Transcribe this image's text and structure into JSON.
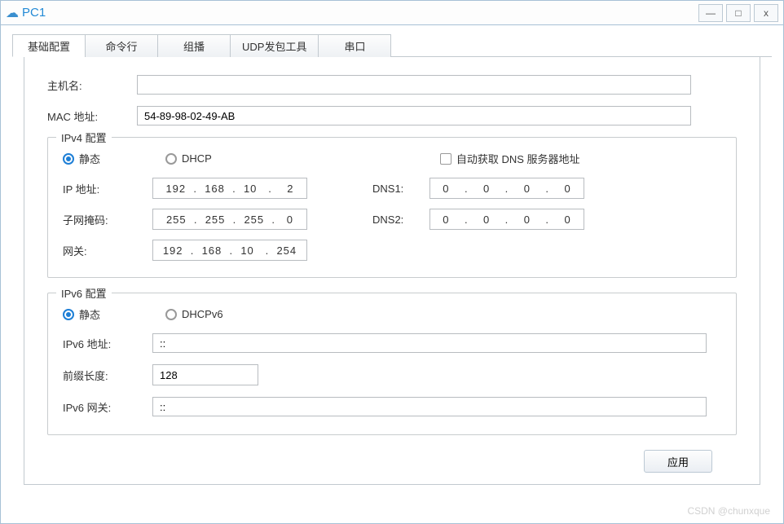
{
  "window": {
    "title": "PC1",
    "controls": {
      "min": "—",
      "max": "□",
      "close": "x"
    }
  },
  "tabs": [
    {
      "label": "基础配置",
      "active": true
    },
    {
      "label": "命令行",
      "active": false
    },
    {
      "label": "组播",
      "active": false
    },
    {
      "label": "UDP发包工具",
      "active": false
    },
    {
      "label": "串口",
      "active": false
    }
  ],
  "basic": {
    "hostname_label": "主机名:",
    "hostname_value": "",
    "mac_label": "MAC 地址:",
    "mac_value": "54-89-98-02-49-AB"
  },
  "ipv4": {
    "legend": "IPv4 配置",
    "radio_static": "静态",
    "radio_dhcp": "DHCP",
    "auto_dns_label": "自动获取 DNS 服务器地址",
    "ip_label": "IP 地址:",
    "ip_value": "192  .  168  .  10   .    2",
    "mask_label": "子网掩码:",
    "mask_value": "255  .  255  .  255  .   0",
    "gw_label": "网关:",
    "gw_value": "192  .  168  .  10   .  254",
    "dns1_label": "DNS1:",
    "dns1_value": "0    .    0    .    0    .    0",
    "dns2_label": "DNS2:",
    "dns2_value": "0    .    0    .    0    .    0"
  },
  "ipv6": {
    "legend": "IPv6 配置",
    "radio_static": "静态",
    "radio_dhcp": "DHCPv6",
    "addr_label": "IPv6 地址:",
    "addr_value": "::",
    "prefix_label": "前缀长度:",
    "prefix_value": "128",
    "gw_label": "IPv6 网关:",
    "gw_value": "::"
  },
  "footer": {
    "apply": "应用"
  },
  "watermark": "CSDN @chunxque"
}
